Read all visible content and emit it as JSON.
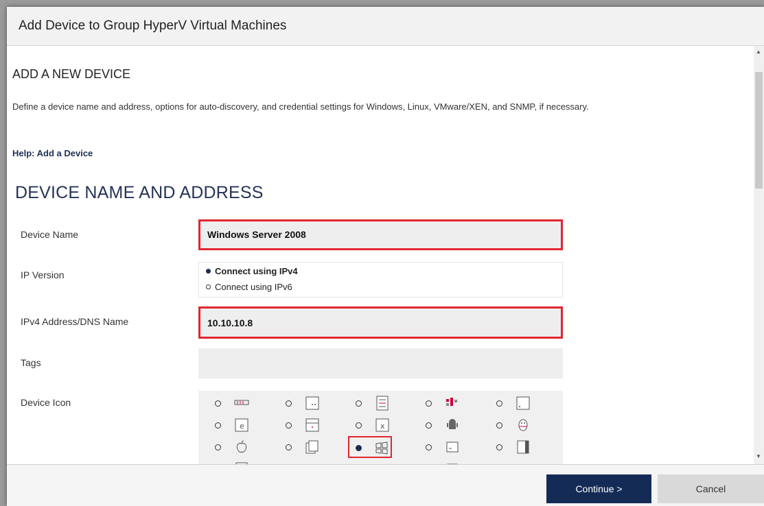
{
  "dialog": {
    "title": "Add Device to Group HyperV Virtual Machines"
  },
  "intro": {
    "heading": "ADD A NEW DEVICE",
    "description": "Define a device name and address, options for auto-discovery, and credential settings for Windows, Linux, VMware/XEN, and SNMP, if necessary.",
    "help_link": "Help: Add a Device"
  },
  "section": {
    "title": "DEVICE NAME AND ADDRESS"
  },
  "form": {
    "device_name": {
      "label": "Device Name",
      "value": "Windows Server 2008"
    },
    "ip_version": {
      "label": "IP Version",
      "options": [
        "Connect using IPv4",
        "Connect using IPv6"
      ],
      "selected": "Connect using IPv4"
    },
    "address": {
      "label": "IPv4 Address/DNS Name",
      "value": "10.10.10.8"
    },
    "tags": {
      "label": "Tags",
      "value": ""
    },
    "device_icon": {
      "label": "Device Icon",
      "options": [
        "rack-icon",
        "server-dots-icon",
        "storage-icon",
        "colored-bars-icon",
        "document-icon",
        "e-device-icon",
        "drive-icon",
        "x-device-icon",
        "android-icon",
        "linux-icon",
        "apple-icon",
        "stack-icon",
        "windows-icon",
        "monitor-icon",
        "disk-icon",
        "generic-box-icon",
        "red-bars-icon",
        "chart-icon",
        "laptop-icon",
        "small-box-icon"
      ],
      "selected": "windows-icon"
    }
  },
  "footer": {
    "continue_label": "Continue >",
    "cancel_label": "Cancel"
  },
  "colors": {
    "primary": "#142b56",
    "highlight": "#e0262f",
    "field_bg": "#eeeeee"
  }
}
